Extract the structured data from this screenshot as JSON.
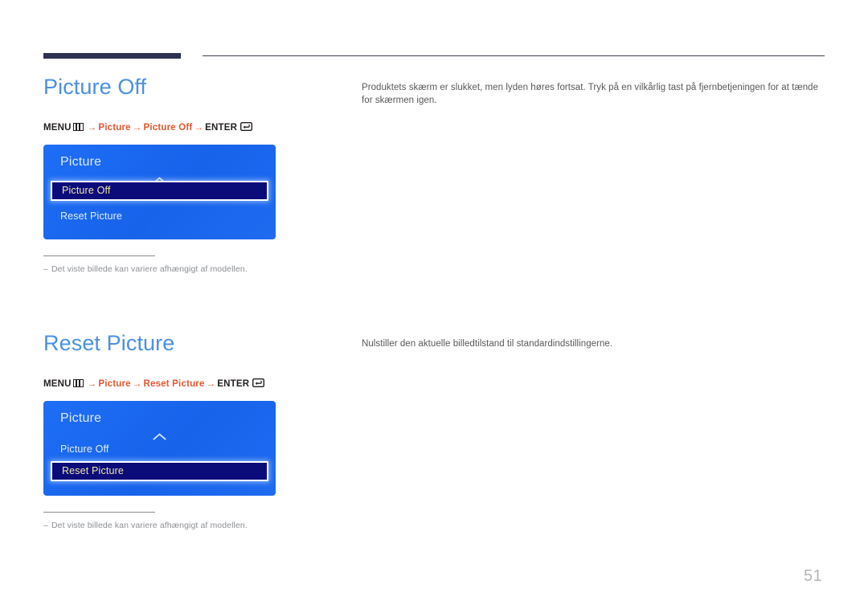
{
  "page": {
    "number": "51",
    "background_color": "#ffffff",
    "accent_color": "#4a90e2",
    "path_accent_color": "#e8552d",
    "header_bar_color": "#2e3151",
    "osd_blue": "#1f6bf0",
    "osd_selected_bg": "#0b0b7a",
    "osd_selected_text": "#f2e6a8"
  },
  "sections": [
    {
      "title": "Picture Off",
      "menu_path": {
        "menu_label": "MENU",
        "menu_icon": "menu-grid-icon",
        "arrow": "→",
        "steps": [
          "Picture",
          "Picture Off"
        ],
        "enter_label": "ENTER",
        "enter_icon": "enter-return-icon"
      },
      "osd": {
        "title": "Picture",
        "caret_icon": "chevron-up-icon",
        "items": [
          {
            "label": "Picture Off",
            "selected": true
          },
          {
            "label": "Reset Picture",
            "selected": false
          }
        ]
      },
      "footnote": {
        "dash": "–",
        "text": "Det viste billede kan variere afhængigt af modellen."
      },
      "description": "Produktets skærm er slukket, men lyden høres fortsat. Tryk på en vilkårlig tast på fjernbetjeningen for at tænde for skærmen igen."
    },
    {
      "title": "Reset Picture",
      "menu_path": {
        "menu_label": "MENU",
        "menu_icon": "menu-grid-icon",
        "arrow": "→",
        "steps": [
          "Picture",
          "Reset Picture"
        ],
        "enter_label": "ENTER",
        "enter_icon": "enter-return-icon"
      },
      "osd": {
        "title": "Picture",
        "caret_icon": "chevron-up-icon",
        "items": [
          {
            "label": "Picture Off",
            "selected": false
          },
          {
            "label": "Reset Picture",
            "selected": true
          }
        ]
      },
      "footnote": {
        "dash": "–",
        "text": "Det viste billede kan variere afhængigt af modellen."
      },
      "description": "Nulstiller den aktuelle billedtilstand til standardindstillingerne."
    }
  ]
}
